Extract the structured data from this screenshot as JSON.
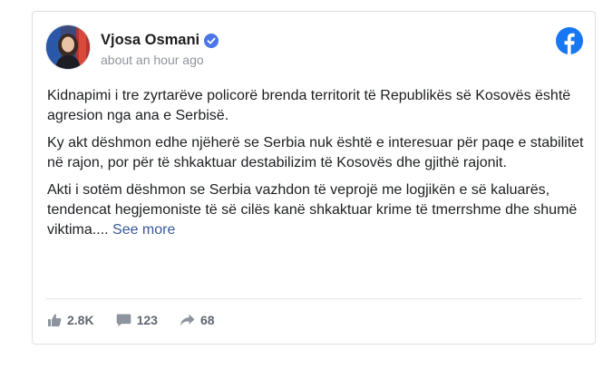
{
  "post": {
    "author": "Vjosa Osmani",
    "timestamp": "about an hour ago",
    "paragraphs": [
      "Kidnapimi i tre zyrtarëve policorë brenda territorit të Republikës së Kosovës është agresion nga ana e Serbisë.",
      "Ky akt dëshmon edhe njëherë se Serbia nuk është e interesuar për paqe e stabilitet në rajon, por për të shkaktuar destabilizim të Kosovës dhe gjithë rajonit.",
      "Akti i sotëm dëshmon se Serbia vazhdon të veprojë me logjikën e së kaluarës, tendencat hegjemoniste të së cilës kanë shkaktuar krime të tmerrshme dhe shumë viktima...."
    ],
    "see_more": "See more"
  },
  "stats": {
    "likes": "2.8K",
    "comments": "123",
    "shares": "68"
  },
  "icons": {
    "verified": "verified-badge-icon",
    "brand": "facebook-logo-icon",
    "like": "thumbs-up-icon",
    "comment": "comment-bubble-icon",
    "share": "share-arrow-icon"
  },
  "colors": {
    "facebook_blue": "#1877f2",
    "link": "#385898",
    "muted": "#606770"
  }
}
